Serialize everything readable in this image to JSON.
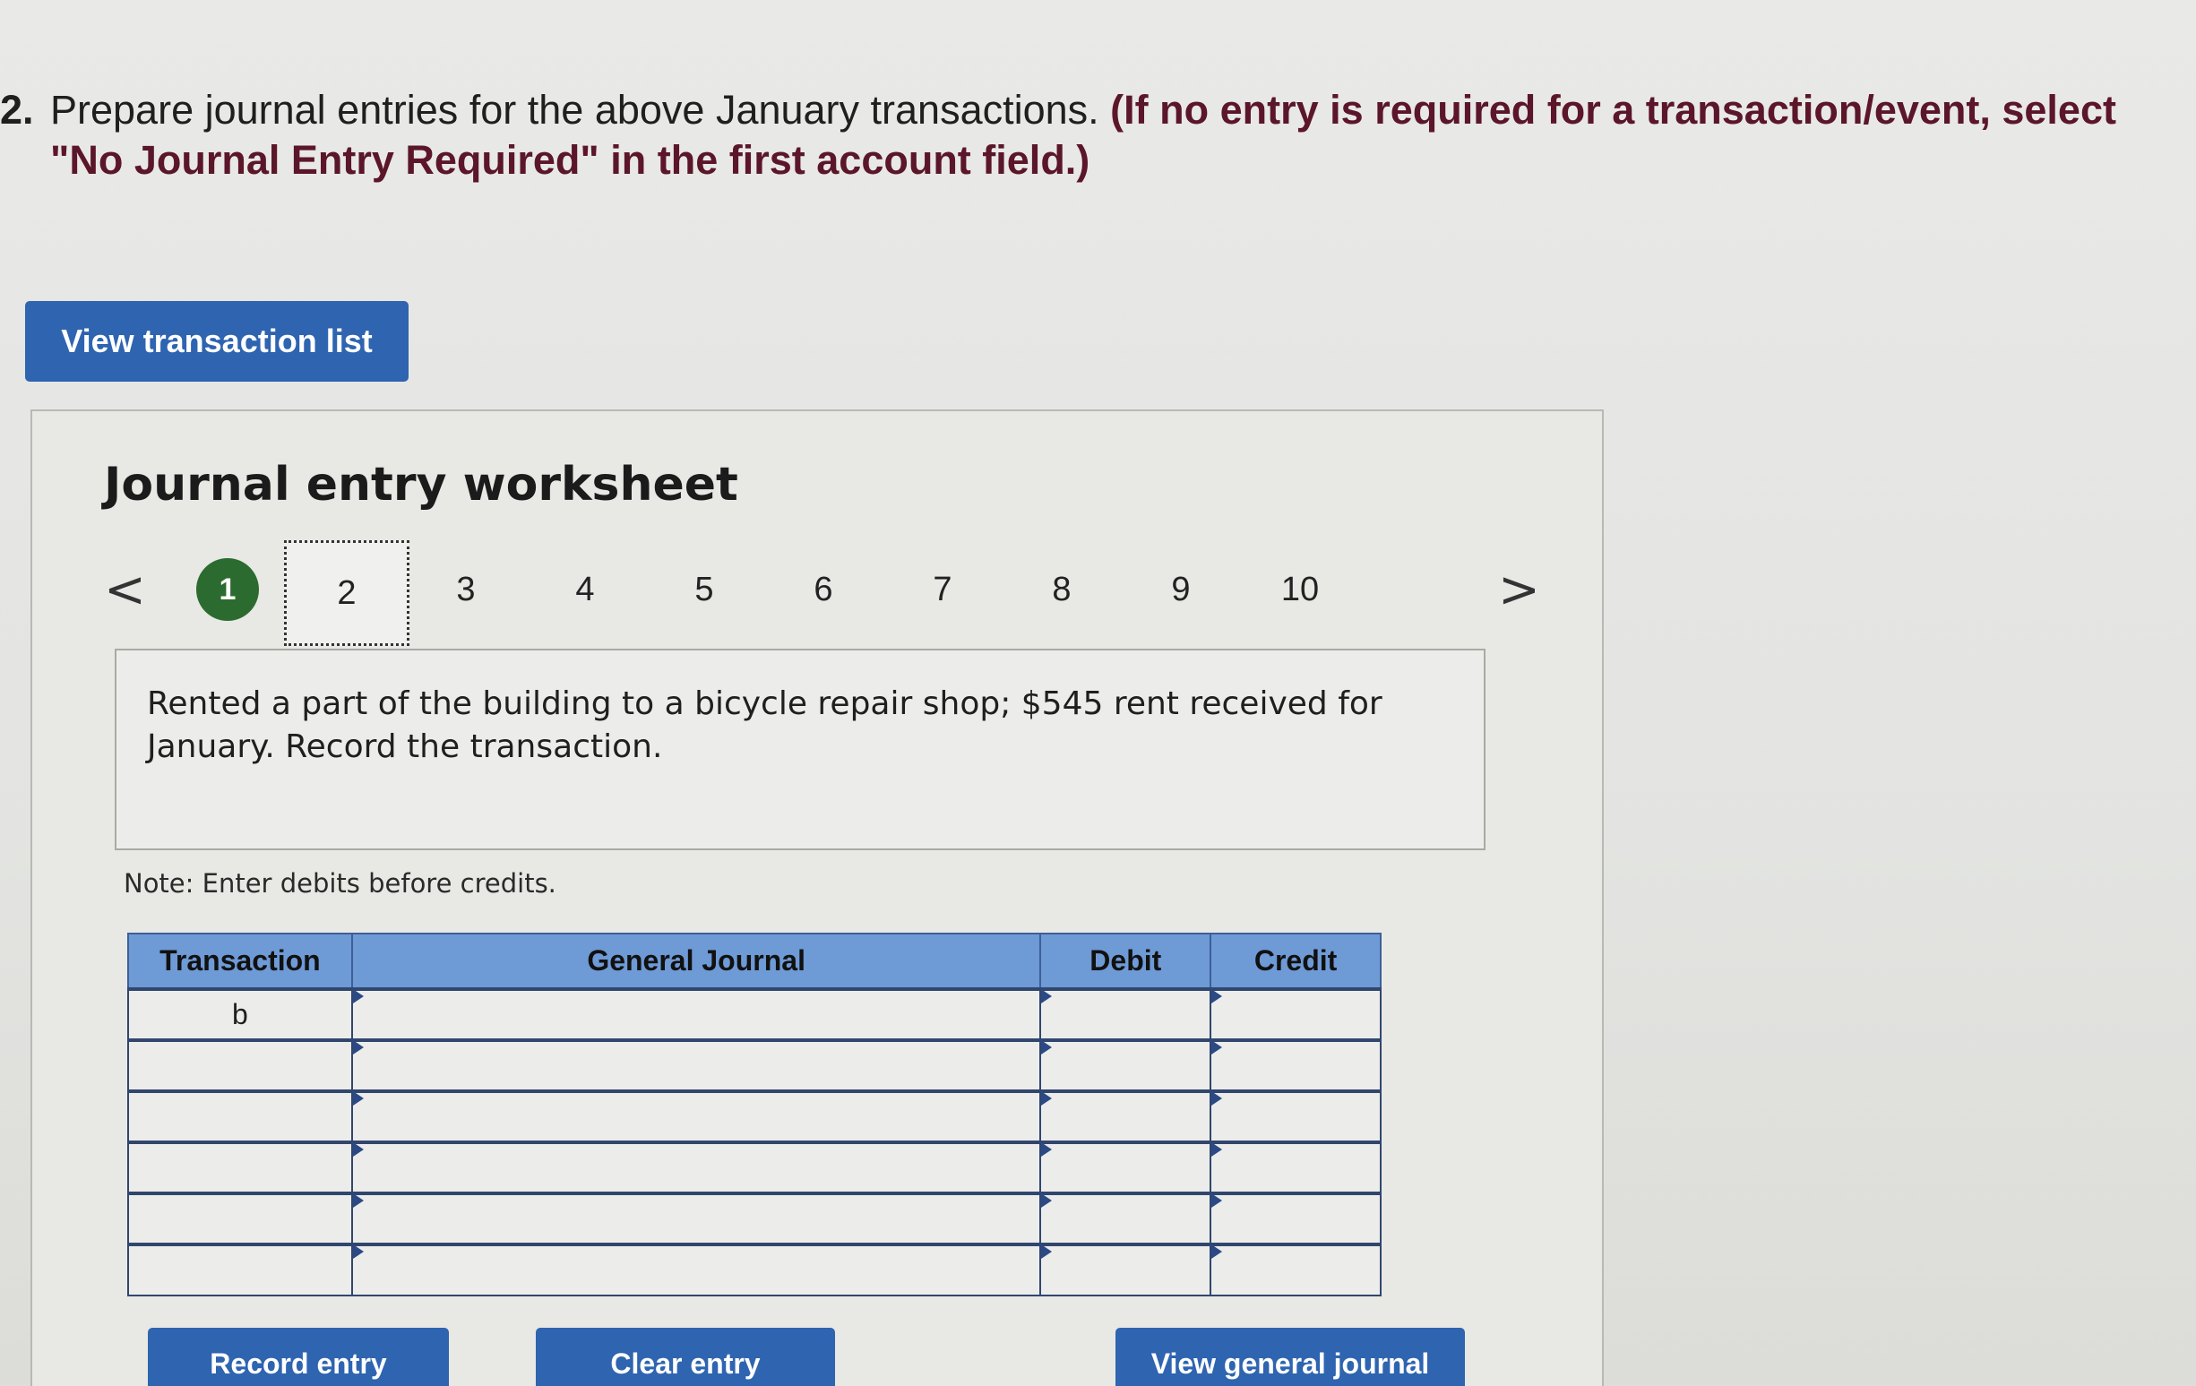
{
  "question": {
    "number": "2.",
    "text": "Prepare journal entries for the above January transactions. ",
    "instruction": "(If no entry is required for a transaction/event, select \"No Journal Entry Required\" in the first account field.)"
  },
  "buttons": {
    "view_transaction_list": "View transaction list",
    "record_entry": "Record entry",
    "clear_entry": "Clear entry",
    "view_general_journal": "View general journal"
  },
  "worksheet": {
    "title": "Journal entry worksheet",
    "prev_arrow": "<",
    "next_arrow": ">",
    "pages": [
      "1",
      "2",
      "3",
      "4",
      "5",
      "6",
      "7",
      "8",
      "9",
      "10"
    ],
    "completed_page": "1",
    "current_page": "2",
    "description": "Rented a part of the building to a bicycle repair shop; $545 rent received for January. Record the transaction.",
    "note": "Note: Enter debits before credits."
  },
  "table": {
    "headers": [
      "Transaction",
      "General Journal",
      "Debit",
      "Credit"
    ],
    "rows": [
      {
        "transaction": "b",
        "account": "",
        "debit": "",
        "credit": ""
      },
      {
        "transaction": "",
        "account": "",
        "debit": "",
        "credit": ""
      },
      {
        "transaction": "",
        "account": "",
        "debit": "",
        "credit": ""
      },
      {
        "transaction": "",
        "account": "",
        "debit": "",
        "credit": ""
      },
      {
        "transaction": "",
        "account": "",
        "debit": "",
        "credit": ""
      },
      {
        "transaction": "",
        "account": "",
        "debit": "",
        "credit": ""
      }
    ]
  },
  "colors": {
    "primary_button": "#2e64b0",
    "instruction_text": "#5b1629",
    "completed_badge": "#2c6b2f",
    "table_header": "#6e9ad6"
  }
}
